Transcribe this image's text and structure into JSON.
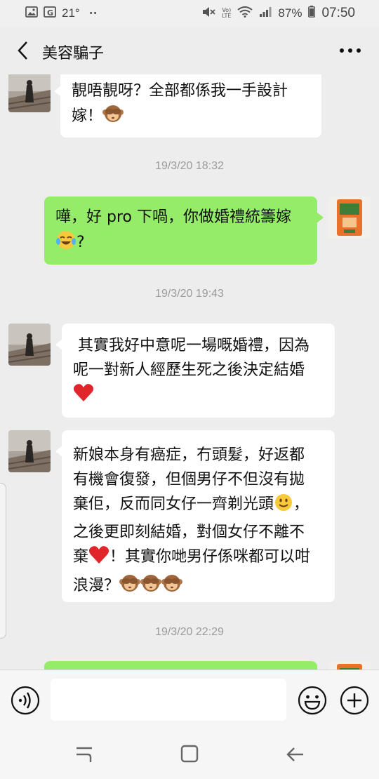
{
  "status_bar": {
    "temperature": "21°",
    "dots": "••",
    "volte_label": "Vo) LTE",
    "battery": "87%",
    "time": "07:50"
  },
  "header": {
    "title": "美容騙子",
    "back_icon": "chevron-left-icon",
    "more_icon": "more-horizontal-icon"
  },
  "messages": [
    {
      "side": "in",
      "lines": [
        "靚唔靚呀？全部都係我一手設計",
        "嫁！"
      ],
      "emoji": "see-no-evil-monkey"
    },
    {
      "timestamp": "19/3/20 18:32"
    },
    {
      "side": "out",
      "lines": [
        "嘩，好 pro 下喎，你做婚禮統籌嫁",
        "?"
      ],
      "emoji": "face-with-tears-of-joy"
    },
    {
      "timestamp": "19/3/20 19:43"
    },
    {
      "side": "in",
      "lines": [
        " 其實我好中意呢一場嘅婚禮，因為",
        "呢一對新人經歷生死之後決定結婚"
      ],
      "emoji": "red-heart"
    },
    {
      "side": "in",
      "lines": [
        "新娘本身有癌症，冇頭髮，好返都",
        "有機會復發，但個男仔不但沒有拋",
        "棄佢，反而同女仔一齊剃光頭",
        "，",
        "之後更即刻結婚，對個女仔不離不",
        "棄",
        "！其實你哋男仔係咪都可以咁",
        "浪漫？"
      ],
      "emoji": "slightly-smiling-face, red-heart, see-no-evil-monkey x3"
    },
    {
      "timestamp": "19/3/20 22:29"
    }
  ],
  "input": {
    "placeholder": "",
    "value": ""
  },
  "icons": {
    "voice": "voice-icon",
    "emoji": "emoji-icon",
    "plus": "plus-circle-icon",
    "recents": "recent-apps-icon",
    "home": "home-icon",
    "back": "back-arrow-icon"
  },
  "colors": {
    "outgoing_bubble": "#95ec69",
    "incoming_bubble": "#ffffff",
    "background": "#ededed",
    "timestamp_text": "#9b9b9b"
  }
}
